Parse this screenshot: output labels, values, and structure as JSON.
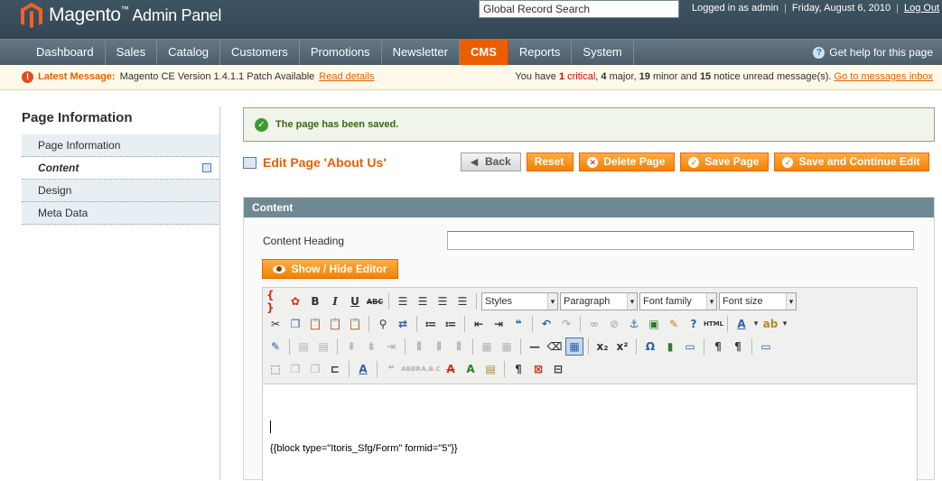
{
  "header": {
    "logo_text": "Magento",
    "logo_tm": "™",
    "logo_sub": "Admin Panel",
    "search_value": "Global Record Search",
    "logged_in": "Logged in as admin",
    "date": "Friday, August 6, 2010",
    "logout": "Log Out"
  },
  "nav": {
    "items": [
      "Dashboard",
      "Sales",
      "Catalog",
      "Customers",
      "Promotions",
      "Newsletter",
      "CMS",
      "Reports",
      "System"
    ],
    "active": "CMS",
    "help": "Get help for this page"
  },
  "notice": {
    "label": "Latest Message:",
    "message": "Magento CE Version 1.4.1.1 Patch Available",
    "read_details": "Read details",
    "right_pre": "You have",
    "critical_count": "1",
    "critical_word": "critical",
    "major": "4",
    "major_word": "major,",
    "minor": "19",
    "minor_word": "minor and",
    "notice_count": "15",
    "notice_word": "notice unread message(s).",
    "inbox_link": "Go to messages inbox"
  },
  "sidebar": {
    "title": "Page Information",
    "tabs": [
      "Page Information",
      "Content",
      "Design",
      "Meta Data"
    ],
    "active_tab": "Content"
  },
  "success": "The page has been saved.",
  "page_title": "Edit Page 'About Us'",
  "buttons": {
    "back": "Back",
    "reset": "Reset",
    "delete": "Delete Page",
    "save": "Save Page",
    "save_continue": "Save and Continue Edit"
  },
  "content": {
    "section_title": "Content",
    "heading_label": "Content Heading",
    "heading_value": "",
    "toggle_editor": "Show / Hide Editor",
    "dropdowns": {
      "styles": "Styles",
      "format": "Paragraph",
      "font_family": "Font family",
      "font_size": "Font size"
    },
    "body_text": "{{block type=\"Itoris_Sfg/Form\" formid=\"5\"}}"
  },
  "colors": {
    "accent": "#eb5e00",
    "header_bg": "#3f5462",
    "section_head": "#6f8992",
    "success_bg": "#eff5ea"
  }
}
